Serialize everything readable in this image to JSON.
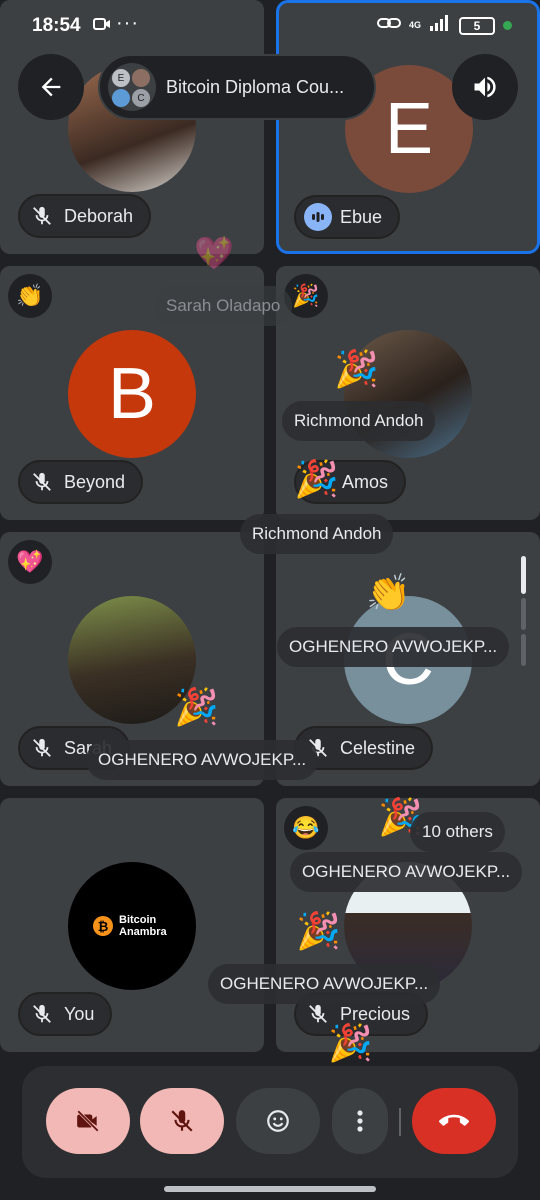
{
  "status_bar": {
    "time": "18:54",
    "network": "4G",
    "battery": "5",
    "more": "···"
  },
  "meeting": {
    "title": "Bitcoin Diploma Cou...",
    "mini_avatar_letters": [
      "E",
      "C"
    ]
  },
  "participants": [
    {
      "name": "Deborah",
      "muted": true
    },
    {
      "name": "Ebue",
      "speaking": true,
      "initial": "E",
      "avatar_color": "#7a4a3a"
    },
    {
      "name": "Beyond",
      "muted": true,
      "initial": "B",
      "avatar_color": "#c5380c",
      "reaction": "👏"
    },
    {
      "name": "Amos",
      "reaction": "🎉"
    },
    {
      "name": "Sarah",
      "muted": true,
      "reaction": "💖"
    },
    {
      "name": "Celestine",
      "muted": true,
      "initial": "C",
      "avatar_color": "#78909c"
    },
    {
      "name": "You",
      "muted": true,
      "avatar_text": "Bitcoin Anambra",
      "avatar_symbol": "₿"
    },
    {
      "name": "Precious",
      "muted": true,
      "reaction": "😂"
    }
  ],
  "floating_labels": {
    "sarah_faded": "Sarah Oladapo",
    "richmond_1": "Richmond Andoh",
    "richmond_2": "Richmond Andoh",
    "oghenero_1": "OGHENERO AVWOJEKP...",
    "oghenero_2": "OGHENERO AVWOJEKP...",
    "oghenero_3": "OGHENERO AVWOJEKP...",
    "oghenero_4": "OGHENERO AVWOJEKP..."
  },
  "others_badge": "10 others",
  "emojis": {
    "party": "🎉",
    "clap": "👏",
    "heart": "💖"
  },
  "colors": {
    "background": "#202124",
    "tile": "#3c4043",
    "active_border": "#1a73e8",
    "muted_button": "#f2b8b5",
    "end_call": "#d93025"
  }
}
